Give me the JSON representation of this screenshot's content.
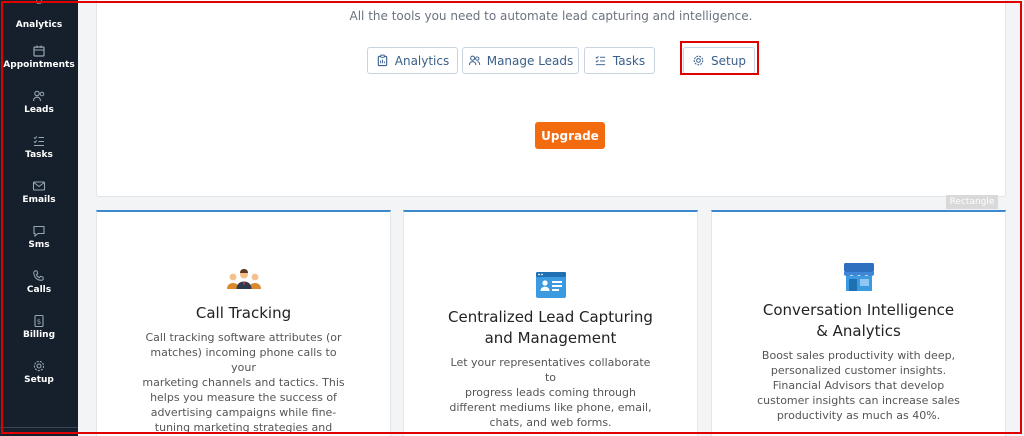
{
  "sidebar": {
    "items": [
      {
        "label": "Analytics",
        "icon": "clipboard-icon"
      },
      {
        "label": "Appointments",
        "icon": "calendar-icon"
      },
      {
        "label": "Leads",
        "icon": "users-icon"
      },
      {
        "label": "Tasks",
        "icon": "checklist-icon"
      },
      {
        "label": "Emails",
        "icon": "mail-icon"
      },
      {
        "label": "Sms",
        "icon": "message-icon"
      },
      {
        "label": "Calls",
        "icon": "phone-icon"
      },
      {
        "label": "Billing",
        "icon": "receipt-icon"
      },
      {
        "label": "Setup",
        "icon": "gear-icon"
      }
    ]
  },
  "hero": {
    "subtitle": "All the tools you need to automate lead capturing and intelligence.",
    "tabs": [
      {
        "label": "Analytics",
        "icon": "clipboard-icon"
      },
      {
        "label": "Manage Leads",
        "icon": "users-icon"
      },
      {
        "label": "Tasks",
        "icon": "checklist-icon"
      },
      {
        "label": "Setup",
        "icon": "gear-icon"
      }
    ],
    "upgrade_label": "Upgrade",
    "rect_tag": "Rectangle"
  },
  "cards": [
    {
      "title": "Call Tracking",
      "icon": "team-people-icon",
      "text_lines": [
        "Call tracking software attributes (or",
        "matches) incoming phone calls to your",
        "marketing channels and tactics. This",
        "helps you measure the success of",
        "advertising campaigns while fine-",
        "tuning marketing strategies and spend."
      ]
    },
    {
      "title_lines": [
        "Centralized Lead Capturing",
        "and Management"
      ],
      "icon": "contact-card-icon",
      "text_lines": [
        "Let your representatives collaborate to",
        "progress leads coming through",
        "different mediums like phone, email,",
        "chats, and web forms."
      ]
    },
    {
      "title_lines": [
        "Conversation Intelligence",
        "& Analytics"
      ],
      "icon": "storefront-icon",
      "text_lines": [
        "Boost sales productivity with deep,",
        "personalized customer insights.",
        "Financial Advisors that develop",
        "customer insights can increase sales",
        "productivity as much as 40%."
      ]
    }
  ],
  "colors": {
    "sidebar_bg": "#16202c",
    "accent_blue": "#3c89cf",
    "upgrade_orange": "#f26b0f",
    "highlight_red": "#e00000"
  }
}
